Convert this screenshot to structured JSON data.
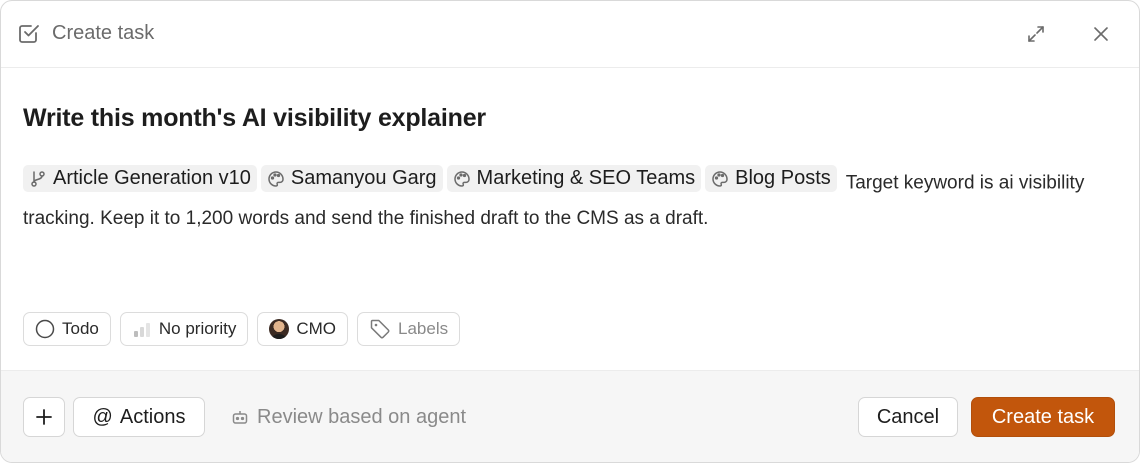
{
  "header": {
    "title": "Create task",
    "icon": "checkbox-icon"
  },
  "task": {
    "title": "Write this month's AI visibility explainer",
    "mentions": [
      {
        "label": "Article Generation v10",
        "icon": "branch-icon"
      },
      {
        "label": "Samanyou Garg",
        "icon": "palette-icon"
      },
      {
        "label": "Marketing & SEO Teams",
        "icon": "palette-icon"
      },
      {
        "label": "Blog Posts",
        "icon": "palette-icon"
      }
    ],
    "description_text": "Target keyword is ai visibility tracking. Keep it to 1,200 words and send the finished draft to the CMS as a draft."
  },
  "properties": {
    "status": "Todo",
    "priority": "No priority",
    "assignee": "CMO",
    "labels": "Labels"
  },
  "footer": {
    "plus": "+",
    "actions": "Actions",
    "review": "Review based on agent",
    "cancel": "Cancel",
    "create": "Create task"
  },
  "colors": {
    "accent": "#c2560c",
    "muted_text": "#8a8a8a",
    "footer_bg": "#f6f6f6"
  }
}
